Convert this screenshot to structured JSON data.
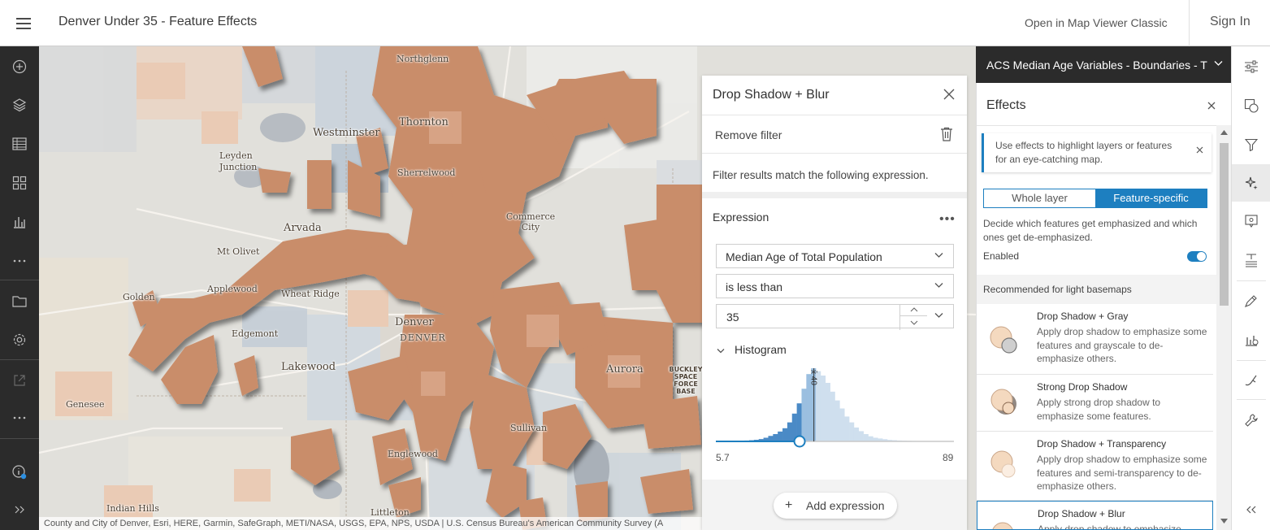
{
  "header": {
    "title": "Denver Under 35 - Feature Effects",
    "open_classic": "Open in Map Viewer Classic",
    "sign_in": "Sign In"
  },
  "left_toolbar": [
    {
      "icon": "add-icon"
    },
    {
      "icon": "layers-icon"
    },
    {
      "icon": "table-icon"
    },
    {
      "icon": "basemap-icon"
    },
    {
      "icon": "chart-icon"
    },
    {
      "icon": "more-icon"
    },
    {
      "icon": "folder-icon"
    },
    {
      "icon": "settings-icon"
    },
    {
      "icon": "share-icon"
    },
    {
      "icon": "more-icon"
    },
    {
      "icon": "info-icon"
    },
    {
      "icon": "expand-icon"
    }
  ],
  "map": {
    "labels": [
      "Northglenn",
      "Westminster",
      "Thornton",
      "Leyden Junction",
      "Sherrelwood",
      "Arvada",
      "Commerce City",
      "Mt Olivet",
      "Golden",
      "Applewood",
      "Wheat Ridge",
      "Edgemont",
      "Denver",
      "DENVER",
      "Lakewood",
      "Aurora",
      "BUCKLEY SPACE FORCE BASE",
      "Genesee",
      "Sullivan",
      "Englewood",
      "Indian Hills",
      "Littleton"
    ],
    "attribution": "County and City of Denver, Esri, HERE, Garmin, SafeGraph, METI/NASA, USGS, EPA, NPS, USDA | U.S. Census Bureau's American Community Survey (A"
  },
  "filter_panel": {
    "title": "Drop Shadow + Blur",
    "remove_filter": "Remove filter",
    "info": "Filter results match the following expression.",
    "expression_label": "Expression",
    "more": "•••",
    "field": "Median Age of Total Population",
    "operator": "is less than",
    "value": "35",
    "histogram_label": "Histogram",
    "histogram_min": "5.7",
    "histogram_max": "89",
    "mean_label": "x̄ 40",
    "add_expression": "Add expression",
    "histogram": {
      "min": 5.7,
      "max": 89,
      "threshold": 35,
      "mean": 40,
      "bins": [
        0.5,
        0.5,
        0.6,
        0.7,
        0.8,
        1,
        1.2,
        1.6,
        2.2,
        3.2,
        5,
        7.5,
        10,
        13.5,
        18,
        26,
        38,
        52,
        72,
        92,
        100,
        96,
        90,
        80,
        68,
        56,
        45,
        34,
        26,
        19,
        14,
        10,
        7,
        5,
        4,
        3,
        2,
        1.6,
        1.2,
        1,
        0.8,
        0.6,
        0.5,
        0.4,
        0.3,
        0.3,
        0.2,
        0.2,
        0.2,
        0.2
      ]
    }
  },
  "layer_header": {
    "title": "ACS Median Age Variables - Boundaries - T"
  },
  "effects": {
    "title": "Effects",
    "notice": "Use effects to highlight layers or features for an eye-catching map.",
    "seg_whole": "Whole layer",
    "seg_feature": "Feature-specific",
    "description": "Decide which features get emphasized and which ones get de-emphasized.",
    "enabled_label": "Enabled",
    "recommended": "Recommended for light basemaps",
    "cards": [
      {
        "title": "Drop Shadow + Gray",
        "desc": "Apply drop shadow to emphasize some features and grayscale to de-emphasize others."
      },
      {
        "title": "Strong Drop Shadow",
        "desc": "Apply strong drop shadow to emphasize some features."
      },
      {
        "title": "Drop Shadow + Transparency",
        "desc": "Apply drop shadow to emphasize some features and semi-transparency to de-emphasize others."
      },
      {
        "title": "Drop Shadow + Blur",
        "desc": "Apply drop shadow to emphasize"
      }
    ]
  },
  "right_toolbar": [
    {
      "icon": "properties-icon"
    },
    {
      "icon": "styles-icon"
    },
    {
      "icon": "filter-icon"
    },
    {
      "icon": "effects-icon"
    },
    {
      "icon": "popups-icon"
    },
    {
      "icon": "labels-icon"
    },
    {
      "icon": "sketch-icon"
    },
    {
      "icon": "fields-icon"
    },
    {
      "icon": "edit-icon"
    },
    {
      "icon": "tools-icon"
    },
    {
      "icon": "collapse-icon"
    }
  ],
  "colors": {
    "accent": "#1d7fc0",
    "dark_bar": "#2b2b2b",
    "feature_fill": "#c98d6a",
    "feature_light": "#e6c4ad",
    "map_bg": "#e3e2dd",
    "histogram_selected": "#4a8ac6",
    "histogram_unselected": "#cfdfee"
  }
}
